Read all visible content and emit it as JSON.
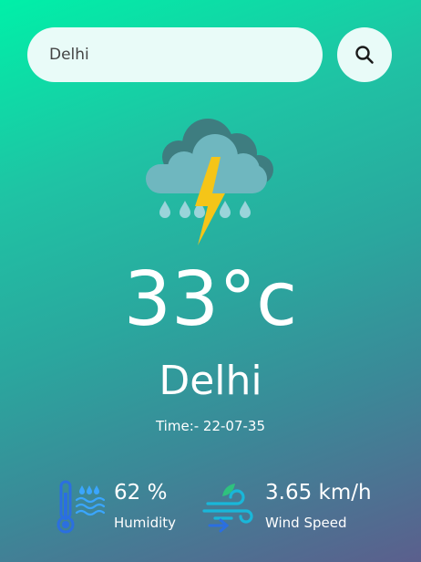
{
  "search": {
    "value": "Delhi",
    "placeholder": "",
    "button_icon": "search-icon"
  },
  "weather": {
    "condition_icon": "thunderstorm-rain-icon",
    "temperature": "33°c",
    "city": "Delhi",
    "time": "Time:- 22-07-35"
  },
  "details": {
    "humidity": {
      "icon": "humidity-thermometer-icon",
      "value": "62 %",
      "label": "Humidity"
    },
    "wind": {
      "icon": "wind-icon",
      "value": "3.65 km/h",
      "label": "Wind Speed"
    }
  },
  "colors": {
    "gradient_top": "#00f0a8",
    "gradient_bottom": "#5b5f8d",
    "input_background": "#e9fbf8",
    "text": "#ffffff",
    "lightning": "#f5c518",
    "cloud_dark": "#3e7d80",
    "cloud_light": "#6fb7bf",
    "raindrop": "#9ad4da"
  }
}
